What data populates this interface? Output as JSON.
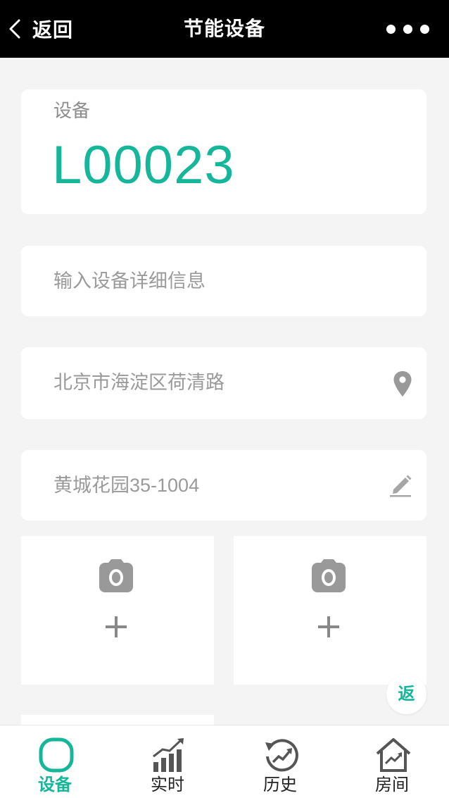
{
  "header": {
    "back_label": "返回",
    "title": "节能设备",
    "more_icon": "more-dots-icon"
  },
  "device": {
    "label": "设备",
    "id": "L00023"
  },
  "detail_input": {
    "placeholder": "输入设备详细信息"
  },
  "address": {
    "value": "北京市海淀区荷清路",
    "icon": "location-pin-icon"
  },
  "room": {
    "value": "黄城花园35-1004",
    "icon": "edit-pencil-icon"
  },
  "photos": [
    {
      "icon": "camera-icon",
      "action_icon": "plus-icon"
    },
    {
      "icon": "camera-icon",
      "action_icon": "plus-icon"
    }
  ],
  "float_button": {
    "label": "返"
  },
  "tabs": [
    {
      "label": "设备",
      "icon": "device-icon",
      "active": true
    },
    {
      "label": "实时",
      "icon": "realtime-chart-icon",
      "active": false
    },
    {
      "label": "历史",
      "icon": "history-icon",
      "active": false
    },
    {
      "label": "房间",
      "icon": "room-house-icon",
      "active": false
    }
  ],
  "colors": {
    "accent": "#16b69a",
    "header_bg": "#000000",
    "page_bg": "#f4f4f4",
    "muted_text": "#9a9a9a",
    "icon_gray": "#999999"
  }
}
